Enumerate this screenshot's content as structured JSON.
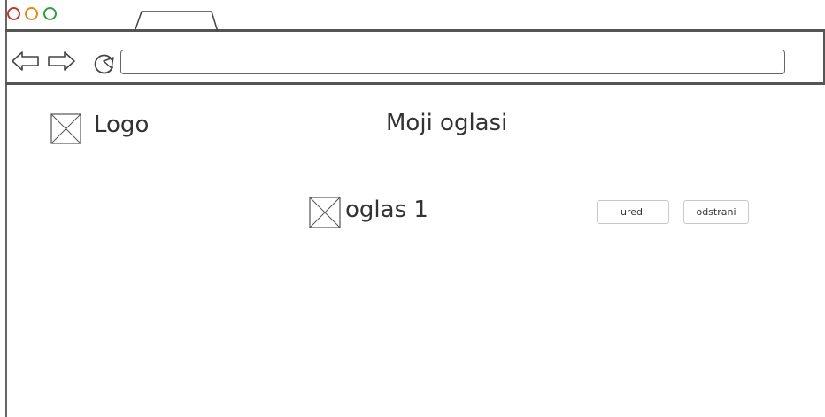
{
  "browser": {
    "window_controls": [
      "close",
      "minimize",
      "maximize"
    ],
    "icons": {
      "back": "back-arrow-icon",
      "forward": "forward-arrow-icon",
      "reload": "reload-icon"
    },
    "address_value": ""
  },
  "header": {
    "logo_label": "Logo",
    "page_title": "Moji oglasi"
  },
  "ads": [
    {
      "title": "oglas 1",
      "edit_label": "uredi",
      "remove_label": "odstrani"
    }
  ],
  "colors": {
    "close": "#c0392b",
    "minimize": "#e08e0b",
    "maximize": "#2e9e3e"
  }
}
